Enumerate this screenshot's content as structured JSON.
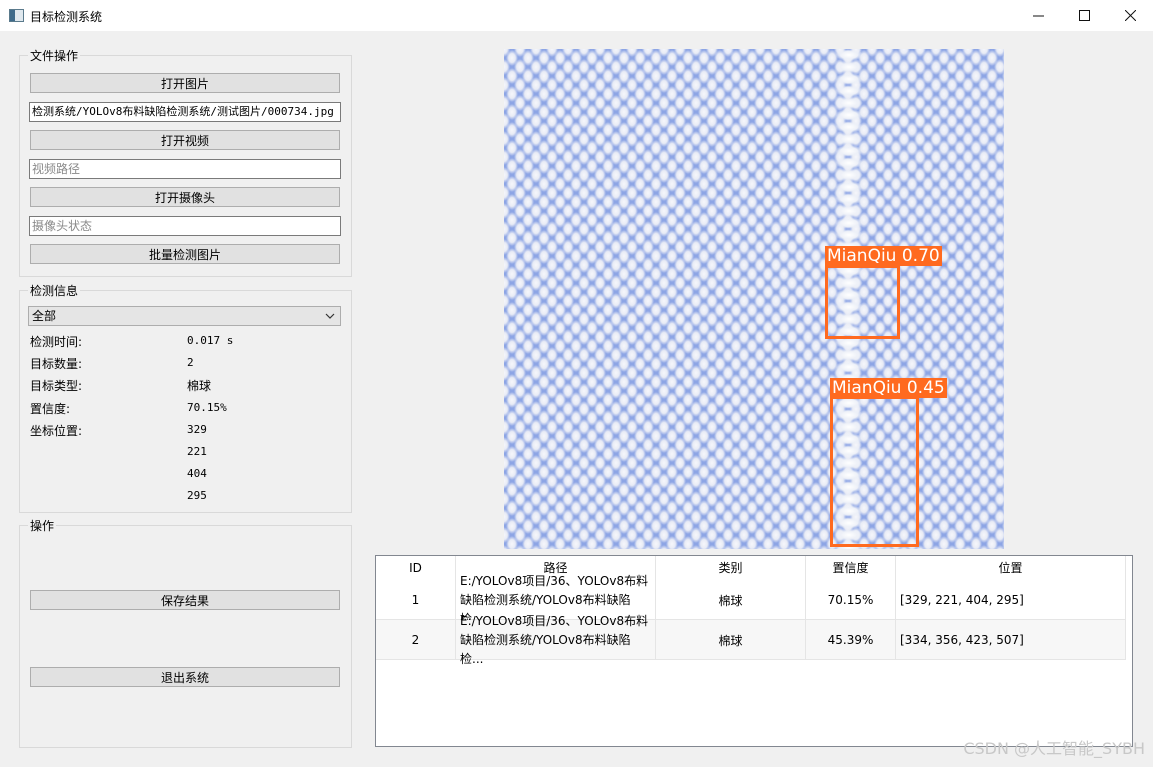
{
  "window": {
    "title": "目标检测系统",
    "minimize_icon": "minimize-icon",
    "maximize_icon": "maximize-icon",
    "close_icon": "close-icon"
  },
  "file_ops": {
    "title": "文件操作",
    "open_image_label": "打开图片",
    "image_path_value": "检测系统/YOLOv8布料缺陷检测系统/测试图片/000734.jpg",
    "open_video_label": "打开视频",
    "video_path_placeholder": "视频路径",
    "open_camera_label": "打开摄像头",
    "camera_status_placeholder": "摄像头状态",
    "batch_detect_label": "批量检测图片"
  },
  "detection_info": {
    "title": "检测信息",
    "filter_selected": "全部",
    "time_label": "检测时间:",
    "time_value": "0.017 s",
    "count_label": "目标数量:",
    "count_value": "2",
    "type_label": "目标类型:",
    "type_value": "棉球",
    "confidence_label": "置信度:",
    "confidence_value": "70.15%",
    "position_label": "坐标位置:",
    "xmin": "329",
    "ymin": "221",
    "xmax": "404",
    "ymax": "295"
  },
  "operations": {
    "title": "操作",
    "save_label": "保存结果",
    "exit_label": "退出系统"
  },
  "detections": [
    {
      "label": "MianQiu 0.70"
    },
    {
      "label": "MianQiu 0.45"
    }
  ],
  "table": {
    "headers": [
      "ID",
      "路径",
      "类别",
      "置信度",
      "位置"
    ],
    "rows": [
      {
        "id": "1",
        "path": "E:/YOLOv8项目/36、YOLOv8布料缺陷检测系统/YOLOv8布料缺陷检...",
        "category": "棉球",
        "confidence": "70.15%",
        "position": "[329, 221, 404, 295]"
      },
      {
        "id": "2",
        "path": "E:/YOLOv8项目/36、YOLOv8布料缺陷检测系统/YOLOv8布料缺陷检...",
        "category": "棉球",
        "confidence": "45.39%",
        "position": "[334, 356, 423, 507]"
      }
    ]
  },
  "watermark": "CSDN @人工智能_SYBH",
  "colors": {
    "detection": "#ff6a1f",
    "fabric": "#8da5e5"
  }
}
